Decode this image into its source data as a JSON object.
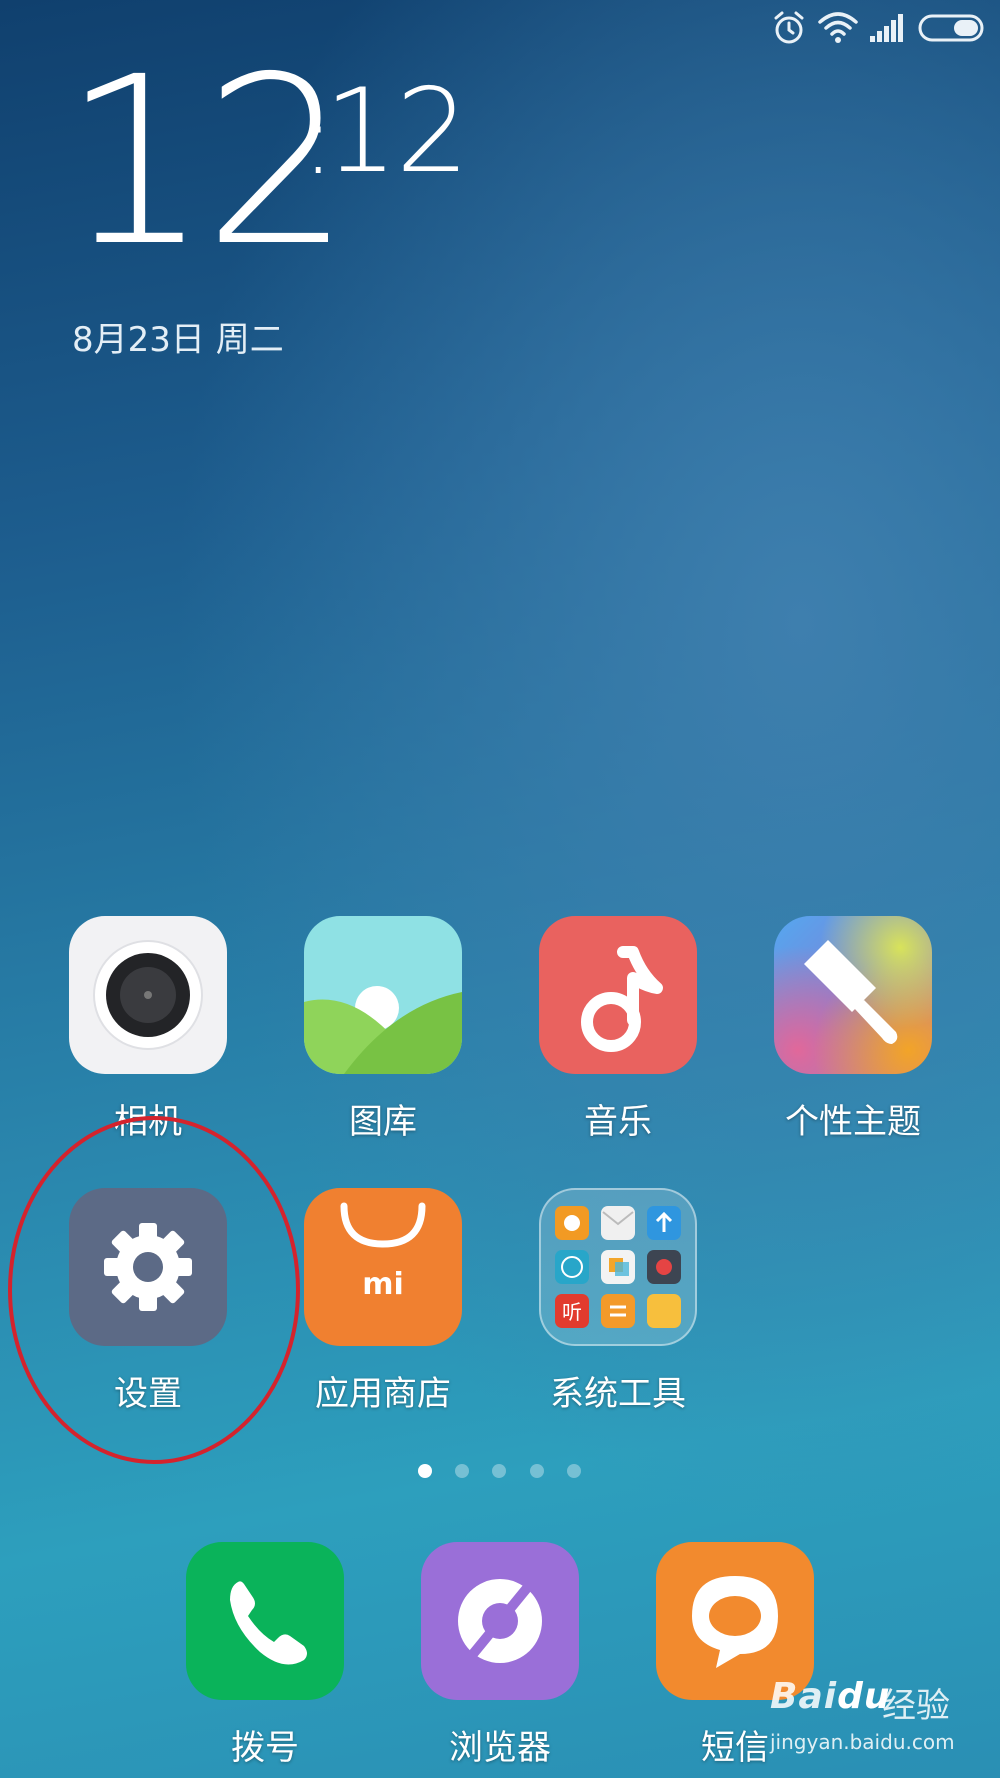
{
  "status_bar": {
    "icons": [
      "alarm-icon",
      "wifi-icon",
      "signal-icon",
      "battery-icon"
    ]
  },
  "clock": {
    "hours": "12",
    "minutes": "12"
  },
  "date": "8月23日 周二",
  "apps": [
    {
      "name": "相机",
      "icon": "camera-icon"
    },
    {
      "name": "图库",
      "icon": "gallery-icon"
    },
    {
      "name": "音乐",
      "icon": "music-note-icon"
    },
    {
      "name": "个性主题",
      "icon": "brush-icon"
    },
    {
      "name": "设置",
      "icon": "gear-icon"
    },
    {
      "name": "应用商店",
      "icon": "app-store-bag-icon"
    },
    {
      "name": "系统工具",
      "icon": "folder-icon"
    }
  ],
  "page_indicator": {
    "count": 5,
    "active": 1
  },
  "dock": [
    {
      "name": "拨号",
      "icon": "phone-icon"
    },
    {
      "name": "浏览器",
      "icon": "browser-icon"
    },
    {
      "name": "短信",
      "icon": "message-bubble-icon"
    }
  ],
  "watermark": {
    "brand": "Bai",
    "brand_suffix": "du",
    "cn": "经验",
    "url": "jingyan.baidu.com"
  },
  "colors": {
    "camera": "#f2f2f4",
    "gallery_sky": "#8fe1e4",
    "gallery_hill": "#8ccf52",
    "music": "#e9625f",
    "settings": "#5c6a86",
    "app_store": "#f08030",
    "phone": "#0ab35a",
    "browser": "#9a6fd8",
    "messages": "#f28a2e",
    "highlight_circle": "#d4232d"
  },
  "mi_logo_text": "mi",
  "folder_glyph": "听"
}
